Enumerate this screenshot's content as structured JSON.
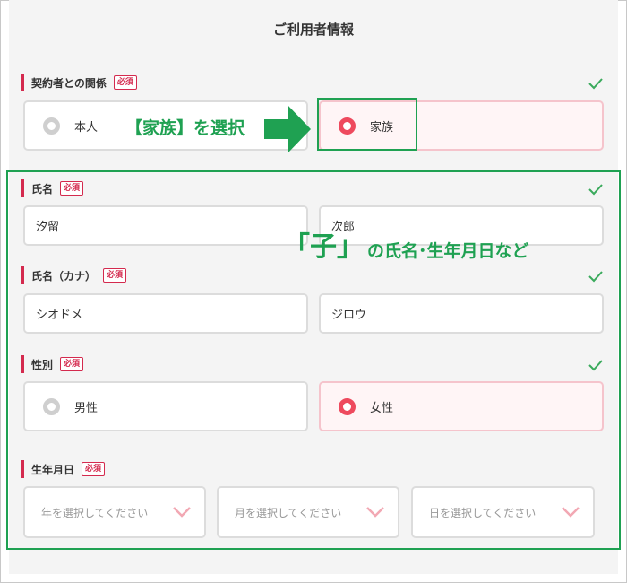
{
  "page_title": "ご利用者情報",
  "required_badge": "必須",
  "colors": {
    "accent_red": "#ee4a5e",
    "label_bar": "#d42a4e",
    "annotation_green": "#1fa152",
    "check_green": "#3aaa5c"
  },
  "relationship": {
    "label": "契約者との関係",
    "options": [
      {
        "label": "本人",
        "selected": false
      },
      {
        "label": "家族",
        "selected": true
      }
    ]
  },
  "name": {
    "label": "氏名",
    "last": "汐留",
    "first": "次郎"
  },
  "kana": {
    "label": "氏名（カナ）",
    "last": "シオドメ",
    "first": "ジロウ"
  },
  "gender": {
    "label": "性別",
    "options": [
      {
        "label": "男性",
        "selected": false
      },
      {
        "label": "女性",
        "selected": true
      }
    ]
  },
  "birthdate": {
    "label": "生年月日",
    "year_placeholder": "年を選択してください",
    "month_placeholder": "月を選択してください",
    "day_placeholder": "日を選択してください"
  },
  "annotations": {
    "select_family": "【家族】を選択",
    "child_info_quote": "「子」",
    "child_info_text": "の氏名･生年月日など"
  },
  "icons": [
    "check-icon",
    "radio-icon",
    "chevron-down-icon",
    "arrow-right-icon"
  ]
}
